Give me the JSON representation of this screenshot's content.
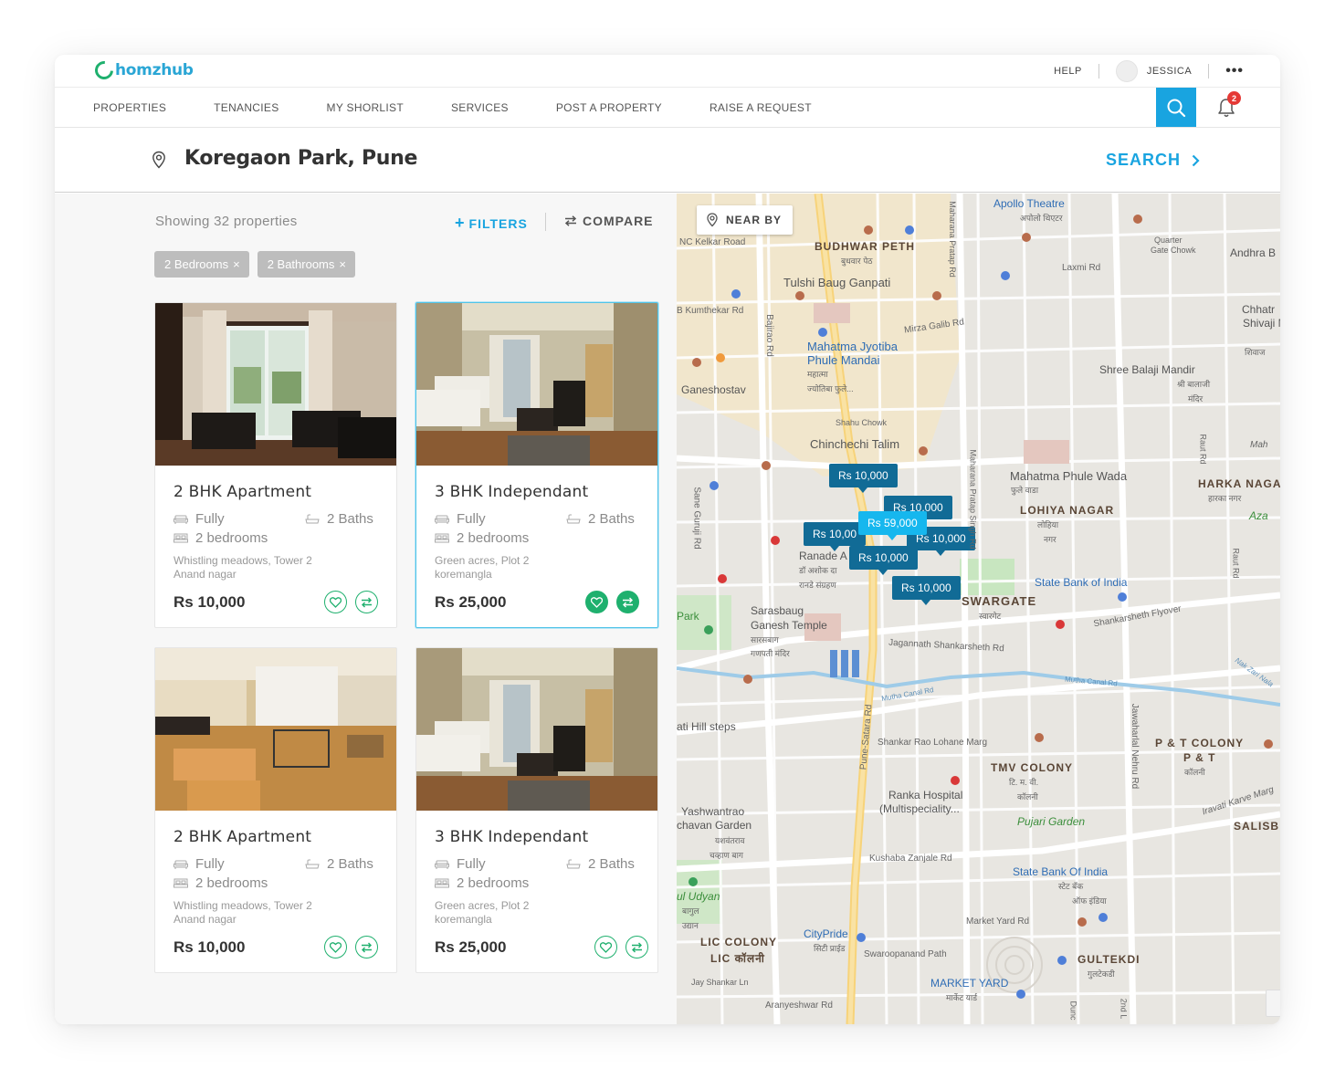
{
  "brand": {
    "name": "homzhub"
  },
  "topbar": {
    "help": "HELP",
    "user_name": "JESSICA",
    "more": "•••"
  },
  "nav": {
    "items": [
      "PROPERTIES",
      "TENANCIES",
      "MY SHORLIST",
      "SERVICES",
      "POST A PROPERTY",
      "RAISE A REQUEST"
    ],
    "notification_count": "2"
  },
  "location": {
    "text": "Koregaon Park, Pune",
    "search_label": "SEARCH"
  },
  "list": {
    "showing": "Showing 32 properties",
    "filters_label": "FILTERS",
    "compare_label": "COMPARE",
    "chips": [
      {
        "label": "2 Bedrooms",
        "remove": "×"
      },
      {
        "label": "2 Bathrooms",
        "remove": "×"
      }
    ]
  },
  "cards": [
    {
      "title": "2 BHK Apartment",
      "furnishing": "Fully",
      "baths": "2 Baths",
      "bedrooms": "2 bedrooms",
      "address_line1": "Whistling meadows, Tower 2",
      "address_line2": "Anand nagar",
      "price": "Rs 10,000",
      "selected": false
    },
    {
      "title": "3 BHK Independant",
      "furnishing": "Fully",
      "baths": "2 Baths",
      "bedrooms": "2 bedrooms",
      "address_line1": "Green acres, Plot 2",
      "address_line2": "koremangla",
      "price": "Rs 25,000",
      "selected": true
    },
    {
      "title": "2 BHK Apartment",
      "furnishing": "Fully",
      "baths": "2 Baths",
      "bedrooms": "2 bedrooms",
      "address_line1": "Whistling meadows, Tower 2",
      "address_line2": "Anand nagar",
      "price": "Rs 10,000",
      "selected": false
    },
    {
      "title": "3 BHK Independant",
      "furnishing": "Fully",
      "baths": "2 Baths",
      "bedrooms": "2 bedrooms",
      "address_line1": "Green acres, Plot 2",
      "address_line2": "koremangla",
      "price": "Rs 25,000",
      "selected": false
    }
  ],
  "map": {
    "nearby_label": "NEAR BY",
    "markers": [
      "Rs 10,000",
      "Rs 10,000",
      "Rs 10,00",
      "Rs 59,000",
      "Rs 10,000",
      "Rs 10,000",
      "Rs 10,000"
    ],
    "labels": {
      "apollo": "Apollo Theatre",
      "apollo_hi": "अपोलो थिएटर",
      "quarter_gate": "Quarter",
      "quarter_gate2": "Gate Chowk",
      "andhra": "Andhra B",
      "nc_kelkar": "NC Kelkar Road",
      "budhwar": "BUDHWAR PETH",
      "budhwar_hi": "बुधवार पेठ",
      "laxmi": "Laxmi Rd",
      "tulshi": "Tulshi Baug Ganpati",
      "kumthekar": "B Kumthekar Rd",
      "bajirao": "Bajirao Rd",
      "mirza": "Mirza Galib Rd",
      "chhatra": "Chhatr",
      "shivaji": "Shivaji M",
      "mahatma1": "Mahatma Jyotiba",
      "mahatma2": "Phule Mandai",
      "mahatma_hi1": "महात्मा",
      "mahatma_hi2": "ज्योतिबा फुले...",
      "ganeshostav": "Ganeshostav",
      "shree_balaji": "Shree Balaji Mandir",
      "shree_balaji_hi": "श्री बालाजी",
      "shree_balaji_hi2": "मंदिर",
      "shahu": "Shahu Chowk",
      "chinchechi": "Chinchechi Talim",
      "phule_wada": "Mahatma Phule Wada",
      "phule_wada_hi": "फुले वाडा",
      "lohiya": "LOHIYA NAGAR",
      "lohiya_hi": "लोहिया",
      "lohiya_hi2": "नगर",
      "harka": "HARKA NAGA",
      "harka_hi": "हारका नगर",
      "aza": "Aza",
      "sane_guruji": "Sane Guruji Rd",
      "ranade": "Ranade A",
      "ranade_hi": "डॉ अशोक दा",
      "ranade_hi2": "रानडे संग्रहण",
      "sbi": "State Bank of India",
      "swargate": "SWARGATE",
      "swargate_hi": "स्वारगेट",
      "shankarsheth_fly": "Shankarsheth Flyover",
      "park": "Park",
      "sarasbaug1": "Sarasbaug",
      "sarasbaug2": "Ganesh Temple",
      "sarasbaug_hi1": "सारसबाग",
      "sarasbaug_hi2": "गणपती मंदिर",
      "jaganath": "Jagannath Shankarsheth Rd",
      "mutha1": "Mutha Canal Rd",
      "mutha2": "Mutha Canal Rd",
      "pune_satara": "Pune-Satara Rd",
      "hill_steps": "ati Hill steps",
      "shankar_rao": "Shankar Rao Lohane Marg",
      "pt_colony": "P & T COLONY",
      "pt_colony2": "P & T",
      "pt_colony_hi": "कॉलनी",
      "tmv": "TMV COLONY",
      "tmv_hi": "टि. म. वी.",
      "tmv_hi2": "कॉलनी",
      "jawaharlal": "Jawaharlal Nehru Rd",
      "ranka1": "Ranka Hospital",
      "ranka2": "(Multispeciality...",
      "yashwant1": "Yashwantrao",
      "yashwant2": "chavan Garden",
      "yashwant_hi": "यशवंतराव",
      "yashwant_hi2": "चव्हाण बाग",
      "pujari": "Pujari Garden",
      "karve": "Iravati Karve Marg",
      "salisb": "SALISB",
      "kushaba": "Kushaba Zanjale Rd",
      "sbi2": "State Bank Of India",
      "sbi2_hi": "स्टेट बँक",
      "sbi2_hi2": "ऑफ इंडिया",
      "udyan": "ul Udyan",
      "udyan_hi": "बागुल",
      "udyan_hi2": "उद्यान",
      "market_yard_rd": "Market Yard Rd",
      "lic": "LIC COLONY",
      "lic_hi": "LIC कॉलनी",
      "citypride": "CityPride",
      "citypride_hi": "सिटी प्राईड",
      "swaroop": "Swaroopanand Path",
      "gultekdi": "GULTEKDI",
      "gultekdi_hi": "गुलटेकडी",
      "jay_shankar": "Jay Shankar Ln",
      "market_yard": "MARKET YARD",
      "market_yard_hi": "मार्केट यार्ड",
      "aranyeshwar": "Aranyeshwar Rd",
      "maharana": "Maharana Pratap Singh Rd",
      "maharana2": "Maharana Pratap Rd",
      "raut": "Raut Rd",
      "naik": "Nak Zari Nala",
      "shivaji_hi": "शिवाज",
      "raut2": "Raut Rd",
      "maha": "Mah",
      "dunc": "Dunc",
      "second": "2nd L"
    }
  },
  "colors": {
    "accent": "#19a4e0",
    "green": "#1fb06e",
    "marker": "#116b96",
    "marker_active": "#16b7ee"
  }
}
